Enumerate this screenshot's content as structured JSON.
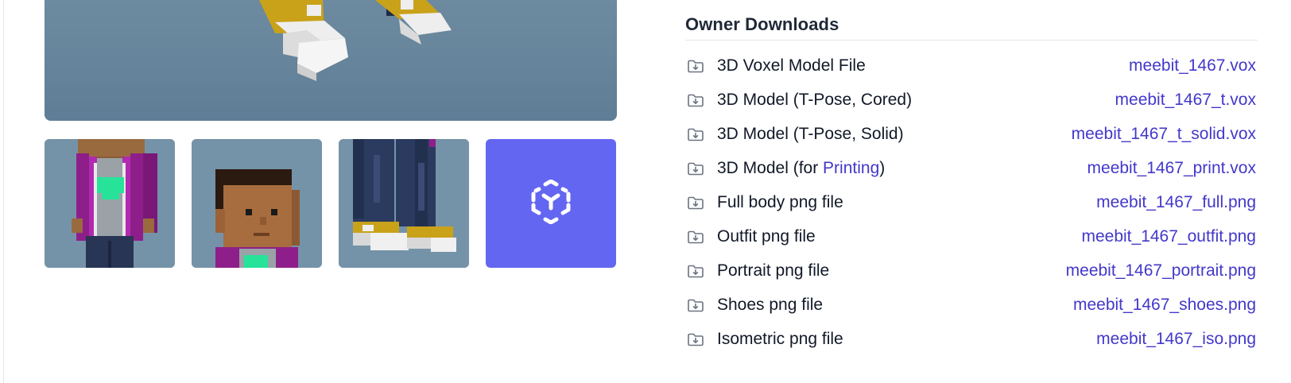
{
  "gallery": {
    "thumbnails": [
      {
        "name": "full-body-thumbnail"
      },
      {
        "name": "portrait-thumbnail"
      },
      {
        "name": "shoes-thumbnail"
      },
      {
        "name": "ar-view-thumbnail",
        "icon": "ar-cube-icon"
      }
    ],
    "ar_button_color": "#6366f1"
  },
  "downloads": {
    "title": "Owner Downloads",
    "link_color": "#4338ca",
    "items": [
      {
        "label": "3D Voxel Model File",
        "file": "meebit_1467.vox"
      },
      {
        "label": "3D Model (T-Pose, Cored)",
        "file": "meebit_1467_t.vox"
      },
      {
        "label": "3D Model (T-Pose, Solid)",
        "file": "meebit_1467_t_solid.vox"
      },
      {
        "label_prefix": "3D Model (for ",
        "label_link": "Printing",
        "label_suffix": ")",
        "file": "meebit_1467_print.vox"
      },
      {
        "label": "Full body png file",
        "file": "meebit_1467_full.png"
      },
      {
        "label": "Outfit png file",
        "file": "meebit_1467_outfit.png"
      },
      {
        "label": "Portrait png file",
        "file": "meebit_1467_portrait.png"
      },
      {
        "label": "Shoes png file",
        "file": "meebit_1467_shoes.png"
      },
      {
        "label": "Isometric png file",
        "file": "meebit_1467_iso.png"
      }
    ]
  }
}
